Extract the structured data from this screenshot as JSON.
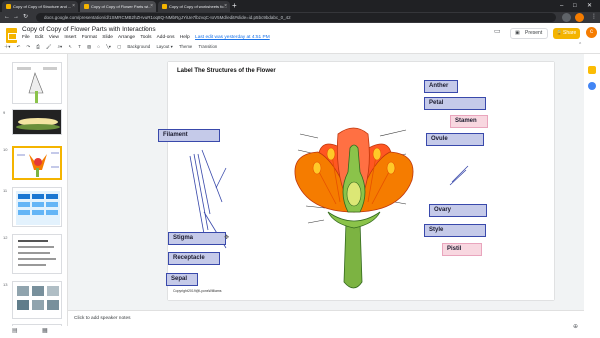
{
  "browser": {
    "tabs": [
      {
        "label": "Copy of Copy of Structure and ..."
      },
      {
        "label": "Copy of Copy of Flower Parts wi..."
      },
      {
        "label": "Copy of Copy of worksheets fo..."
      }
    ],
    "url": "docs.google.com/presentation/d/1SMRCMB2hZHvuR1oq8Q-NMbRgJYiUe7lbzvqC-IoV5Md/edit#slide=id.p5bc9bdabc_0_42"
  },
  "app": {
    "title": "Copy of Copy of Flower Parts with Interactions",
    "menus": [
      "File",
      "Edit",
      "View",
      "Insert",
      "Format",
      "Slide",
      "Arrange",
      "Tools",
      "Add-ons",
      "Help"
    ],
    "last_edit": "Last edit was yesterday at 4:51 PM",
    "present_label": "Present",
    "share_label": "Share",
    "user_initial": "c",
    "toolbar": [
      "Background",
      "Layout ▾",
      "Theme",
      "Transition"
    ]
  },
  "filmstrip": {
    "numbers": [
      "",
      "9",
      "10",
      "11",
      "12",
      "13",
      "14",
      "15"
    ]
  },
  "slide": {
    "title": "Label The Structures of the Flower",
    "copyright": "Copyright2019@LyonsWilliams",
    "labels": {
      "anther": "Anther",
      "petal": "Petal",
      "stamen": "Stamen",
      "ovule": "Ovule",
      "filament": "Filament",
      "ovary": "Ovary",
      "style": "Style",
      "pistil": "Pistil",
      "stigma": "Stigma",
      "receptacle": "Receptacle",
      "sepal": "Sepal"
    }
  },
  "notes": {
    "placeholder": "Click to add speaker notes"
  },
  "colors": {
    "label_fill": "#c5cae9",
    "label_border": "#3949ab",
    "label_pink": "#f8d7e0",
    "accent": "#f4b400"
  }
}
